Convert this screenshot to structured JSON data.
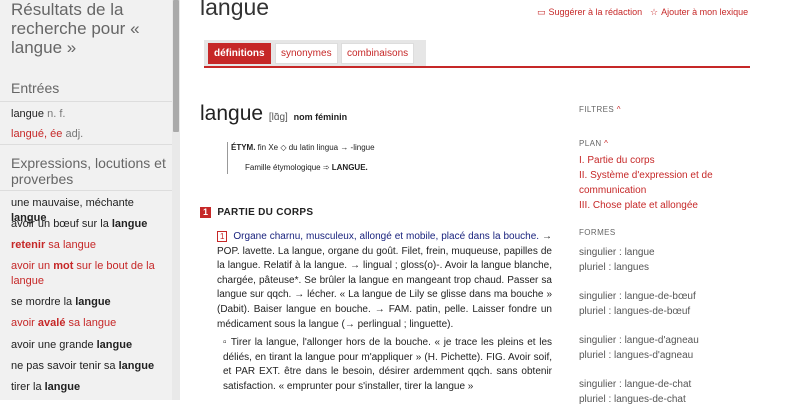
{
  "sidebar": {
    "title": "Résultats de la recherche pour « langue »",
    "entries_heading": "Entrées",
    "entries": [
      {
        "word": "langue",
        "gram": "n. f."
      },
      {
        "word": "langué, ée",
        "gram": "adj."
      }
    ],
    "expressions_heading": "Expressions, locutions et proverbes",
    "expressions": [
      {
        "a": "une mauvaise, méchante ",
        "b": "langue",
        "c": ""
      },
      {
        "a": "avoir un bœuf sur la ",
        "b": "langue",
        "c": ""
      },
      {
        "a": "retenir",
        "b": " sa langue",
        "c": ""
      },
      {
        "a": "avoir un ",
        "b": "mot",
        "c": " sur le bout de la langue"
      },
      {
        "a": "se mordre la ",
        "b": "langue",
        "c": ""
      },
      {
        "a": "avoir ",
        "b": "avalé",
        "c": " sa langue"
      },
      {
        "a": "avoir une grande ",
        "b": "langue",
        "c": ""
      },
      {
        "a": "ne pas savoir tenir sa ",
        "b": "langue",
        "c": ""
      },
      {
        "a": "tirer la ",
        "b": "langue",
        "c": ""
      }
    ]
  },
  "header": {
    "word": "langue",
    "suggest_label": "Suggérer à la rédaction",
    "lexicon_label": "Ajouter à mon lexique"
  },
  "tabs": [
    {
      "label": "définitions",
      "active": true
    },
    {
      "label": "synonymes",
      "active": false
    },
    {
      "label": "combinaisons",
      "active": false
    }
  ],
  "entry": {
    "headword": "langue",
    "pron": "[lɑ̃g]",
    "gram": "nom féminin",
    "etym": {
      "label": "ÉTYM.",
      "text": " fin Xe ◇ du latin lingua → -lingue",
      "family_label": "Famille étymologique ➾ ",
      "family_word": "LANGUE."
    },
    "section_num": "1",
    "section_title": "PARTIE DU CORPS",
    "sense_num": "1",
    "def_lines": [
      "Organe charnu, musculeux, allongé et mobile, placé dans la bouche.",
      "→ POP. lavette. La langue, organe du goût. Filet, frein, muqueuse, papilles de la langue. Relatif à la langue. → lingual ; gloss(o)-. Avoir la langue blanche, chargée, pâteuse*. Se brûler la langue en mangeant trop chaud. Passer sa langue sur qqch. → lécher. « La langue de Lily se glisse dans ma bouche » (Dabit). Baiser langue en bouche. → FAM. patin, pelle. Laisser fondre un médicament sous la langue (→ perlingual ; linguette).",
      "▫ Tirer la langue, l'allonger hors de la bouche. « je trace les pleins et les déliés, en tirant la langue pour m'appliquer » (H. Pichette). FIG. Avoir soif, et PAR EXT. être dans le besoin, désirer ardemment qqch. sans obtenir satisfaction. « emprunter pour s'installer, tirer la langue »"
    ]
  },
  "right": {
    "filters_label": "FILTRES",
    "plan_label": "PLAN",
    "plan_items": [
      "I. Partie du corps",
      "II. Système d'expression et de communication",
      "III. Chose plate et allongée"
    ],
    "forms_label": "FORMES",
    "forms": [
      [
        "singulier : langue",
        "pluriel : langues"
      ],
      [
        "singulier : langue-de-bœuf",
        "pluriel : langues-de-bœuf"
      ],
      [
        "singulier : langue-d'agneau",
        "pluriel : langues-d'agneau"
      ],
      [
        "singulier : langue-de-chat",
        "pluriel : langues-de-chat"
      ]
    ]
  },
  "colors": {
    "accent": "#c62828",
    "sidebar_bg": "#f1f1f1",
    "link_blue": "#1a237e"
  }
}
